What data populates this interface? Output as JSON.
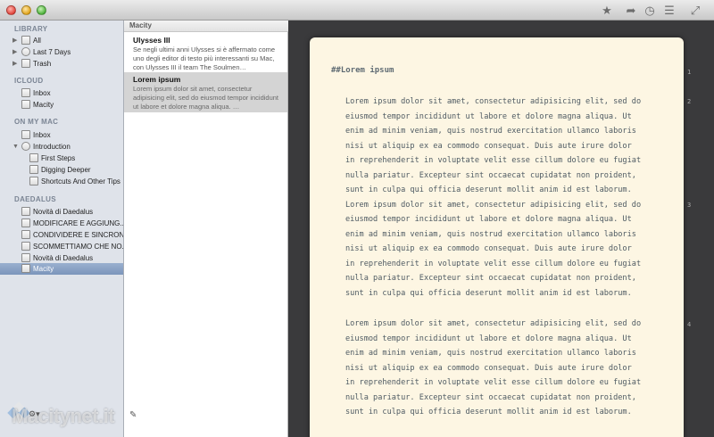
{
  "library": {
    "sections": [
      {
        "title": "LIBRARY",
        "items": [
          "All",
          "Last 7 Days",
          "Trash"
        ]
      },
      {
        "title": "ICLOUD",
        "items": [
          "Inbox",
          "Macity"
        ]
      },
      {
        "title": "ON MY MAC",
        "items": [
          "Inbox",
          "Introduction",
          "First Steps",
          "Digging Deeper",
          "Shortcuts And Other Tips"
        ]
      },
      {
        "title": "DAEDALUS",
        "items": [
          "Novità di Daedalus",
          "MODIFICARE E AGGIUNG...",
          "CONDIVIDERE E SINCRON...",
          "SCOMMETTIAMO CHE NO...",
          "Novità di Daedalus",
          "Macity"
        ]
      }
    ],
    "watermark": "Macitynet.it"
  },
  "sheets": {
    "header": "Macity",
    "items": [
      {
        "title": "Ulysses III",
        "preview": "Se negli ultimi anni Ulysses si è affermato come uno degli editor di testo più interessanti su Mac, con Ulysses III il team The Soulmen…"
      },
      {
        "title": "Lorem ipsum",
        "preview": "Lorem ipsum dolor sit amet, consectetur adipisicing elit, sed do eiusmod tempor incididunt ut labore et dolore magna aliqua. …"
      }
    ]
  },
  "editor": {
    "heading": "##Lorem ipsum",
    "paragraphs": [
      "Lorem ipsum dolor sit amet, consectetur adipisicing elit, sed do\neiusmod tempor incididunt ut labore et dolore magna aliqua. Ut\nenim ad minim veniam, quis nostrud exercitation ullamco laboris\nnisi ut aliquip ex ea commodo consequat. Duis aute irure dolor\nin reprehenderit in voluptate velit esse cillum dolore eu fugiat\nnulla pariatur. Excepteur sint occaecat cupidatat non proident,\nsunt in culpa qui officia deserunt mollit anim id est laborum.\nLorem ipsum dolor sit amet, consectetur adipisicing elit, sed do\neiusmod tempor incididunt ut labore et dolore magna aliqua. Ut\nenim ad minim veniam, quis nostrud exercitation ullamco laboris\nnisi ut aliquip ex ea commodo consequat. Duis aute irure dolor\nin reprehenderit in voluptate velit esse cillum dolore eu fugiat\nnulla pariatur. Excepteur sint occaecat cupidatat non proident,\nsunt in culpa qui officia deserunt mollit anim id est laborum.",
      "Lorem ipsum dolor sit amet, consectetur adipisicing elit, sed do\neiusmod tempor incididunt ut labore et dolore magna aliqua. Ut\nenim ad minim veniam, quis nostrud exercitation ullamco laboris\nnisi ut aliquip ex ea commodo consequat. Duis aute irure dolor\nin reprehenderit in voluptate velit esse cillum dolore eu fugiat\nnulla pariatur. Excepteur sint occaecat cupidatat non proident,\nsunt in culpa qui officia deserunt mollit anim id est laborum."
    ],
    "line_numbers": [
      "1",
      "2",
      "3",
      "4"
    ]
  }
}
